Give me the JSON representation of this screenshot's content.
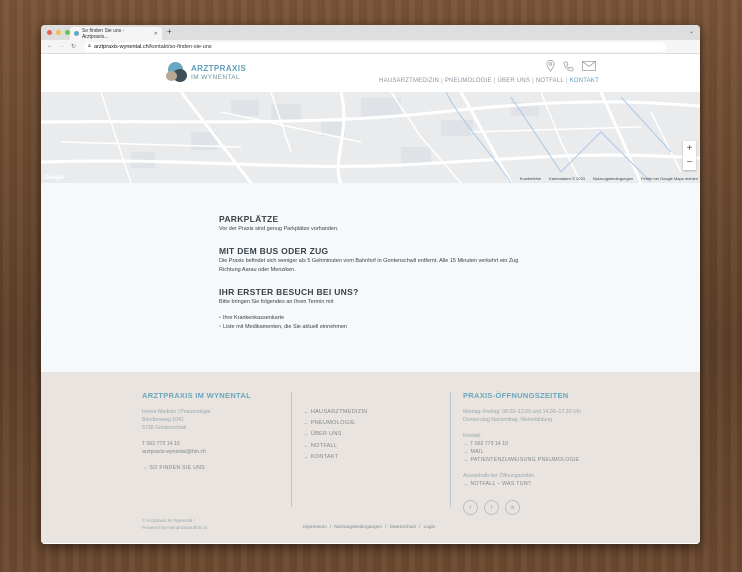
{
  "browser": {
    "tab_title": "So finden Sie uns - Arztpraxis...",
    "new_tab": "+",
    "url_domain": "arztpraxis-wynental.ch",
    "url_path": "/kontakt/so-finden-sie-uns"
  },
  "header": {
    "brand_line1": "ARZTPRAXIS",
    "brand_line2": "IM WYNENTAL",
    "menu": [
      {
        "label": "HAUSARZTMEDIZIN"
      },
      {
        "label": "PNEUMOLOGIE"
      },
      {
        "label": "ÜBER UNS"
      },
      {
        "label": "NOTFALL"
      },
      {
        "label": "KONTAKT"
      }
    ],
    "icons": [
      "map-pin-icon",
      "phone-icon",
      "mail-icon"
    ]
  },
  "map": {
    "zoom_in": "+",
    "zoom_out": "−",
    "attribution_google": "Google",
    "footer_links": [
      "Kurzbefehle",
      "Kartendaten © 2023",
      "Nutzungsbedingungen",
      "Fehler bei Google Maps melden"
    ]
  },
  "content": {
    "sections": [
      {
        "title": "PARKPLÄTZE",
        "text": "Vor der Praxis sind genug Parkplätze vorhanden."
      },
      {
        "title": "MIT DEM BUS ODER ZUG",
        "text": "Die Praxis befindet sich weniger als 5 Gehminuten vom Bahnhof in Gontenschwil entfernt. Alle 15 Minuten verkehrt ein Zug Richtung Aarau oder Menziken."
      },
      {
        "title": "IHR ERSTER BESUCH BEI UNS?",
        "text": "Bitte bringen Sie folgendes an Ihren Termin mit"
      }
    ],
    "bring_items": [
      "Ihre Krankenkassenkarte",
      "Liste mit Medikamenten, die Sie aktuell einnehmen"
    ]
  },
  "footer": {
    "col1": {
      "title": "ARZTPRAXIS IM WYNENTAL",
      "specialty": "Innere Medizin | Pneumologie",
      "street": "Bündtenweg 1041",
      "city": "5728 Gontenschwil",
      "phone": "T 062 773 14 10",
      "email": "arztpraxis-wynental@hin.ch",
      "find_link": "SO FINDEN SIE UNS"
    },
    "col2": [
      "HAUSARZTMEDIZIN",
      "PNEUMOLOGIE",
      "ÜBER UNS",
      "NOTFALL",
      "KONTAKT"
    ],
    "col3": {
      "title": "PRAXIS-ÖFFNUNGSZEITEN",
      "hours1": "Montag–Freitag: 08.00–12.00 und 14.00–17.30 Uhr",
      "hours2": "Donnerstag Nachmittag: Weiterbildung",
      "contact_label": "Kontakt",
      "contact_phone": "T 062 773 14 10",
      "contact_mail": "MAIL",
      "contact_referral": "PATIENTENZUWEISUNG PNEUMOLOGIE",
      "outside_label": "Ausserhalb der Öffnungszeiten",
      "outside_link": "NOTFALL – WAS TUN?",
      "social": [
        "twitter-icon",
        "facebook-icon",
        "linkedin-icon"
      ]
    },
    "copyright1": "© Arztpraxis im Wynental /",
    "copyright2": "Powered by meinpraxisauftritt.ch",
    "legal": [
      "Impressum",
      "Nutzungsbedingungen",
      "Datenschutz",
      "Login"
    ]
  }
}
